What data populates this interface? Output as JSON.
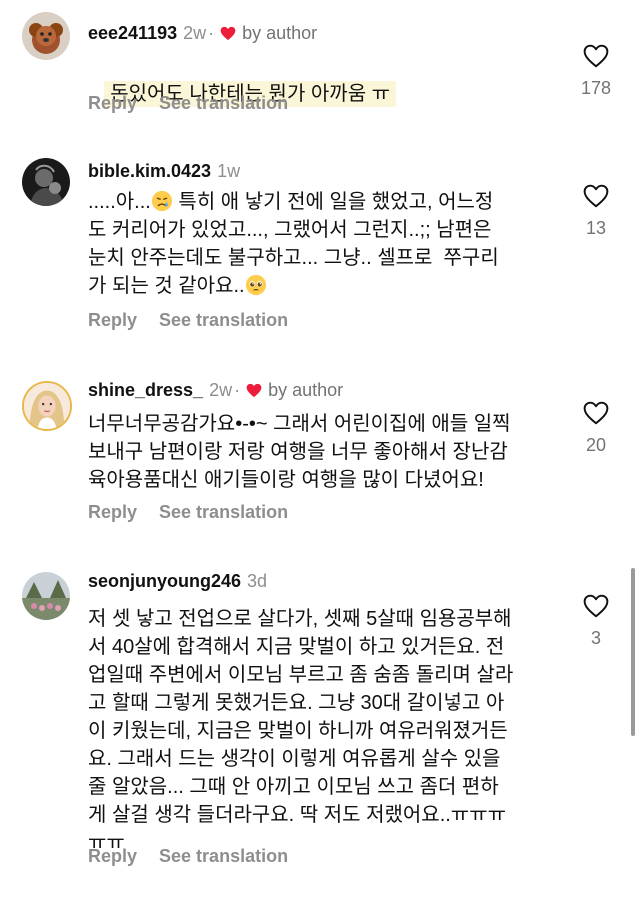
{
  "comments": [
    {
      "username": "eee241193",
      "age": "2w",
      "liked_by": "by author",
      "text": "돈있어도 나한테는 뭔가 아까움 ㅠ",
      "reply": "Reply",
      "translate": "See translation",
      "likes": "178"
    },
    {
      "username": "bible.kim.0423",
      "age": "1w",
      "text_1": ".....아...",
      "emoji_1": "crying-face",
      "text_2": " 특히 애 낳기 전에 일을 했었고, 어느정\n도 커리어가 있었고..., 그랬어서 그런지..;; 남편은\n눈치 안주는데도 불구하고... 그냥.. 셀프로  쭈구리\n가 되는 것 같아요..",
      "emoji_2": "pleading-face",
      "reply": "Reply",
      "translate": "See translation",
      "likes": "13"
    },
    {
      "username": "shine_dress_",
      "age": "2w",
      "liked_by": "by author",
      "text": "너무너무공감가요•-•~ 그래서 어린이집에 애들 일찍\n보내구 남편이랑 저랑 여행을 너무 좋아해서 장난감\n육아용품대신 애기들이랑 여행을 많이 다녔어요!",
      "reply": "Reply",
      "translate": "See translation",
      "likes": "20"
    },
    {
      "username": "seonjunyoung246",
      "age": "3d",
      "text": "저 셋 낳고 전업으로 살다가, 셋째 5살때 임용공부해\n서 40살에 합격해서 지금 맞벌이 하고 있거든요. 전\n업일때 주변에서 이모님 부르고 좀 숨좀 돌리며 살라\n고 할때 그렇게 못했거든요. 그냥 30대 갈이넣고 아\n이 키웠는데, 지금은 맞벌이 하니까 여유러워졌거든\n요. 그래서 드는 생각이 이렇게 여유롭게 살수 있을\n줄 알았음... 그때 안 아끼고 이모님 쓰고 좀더 편하\n게 살걸 생각 들더라구요. 딱 저도 저랬어요..ㅠㅠㅠ\nㅠㅠ",
      "reply": "Reply",
      "translate": "See translation",
      "likes": "3"
    }
  ],
  "colors": {
    "text": "#111111",
    "muted": "#8e8e8e",
    "heart_red": "#ed1c3a",
    "highlight": "#fcf6d8"
  },
  "icons": [
    "heart-outline-icon",
    "heart-filled-icon",
    "crying-face-emoji",
    "pleading-face-emoji"
  ]
}
